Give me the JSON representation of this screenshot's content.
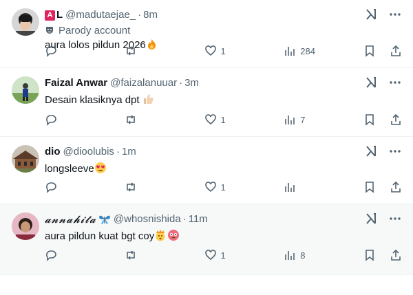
{
  "posts": [
    {
      "badge": "A",
      "name": "L",
      "handle": "@madutaejae_",
      "dot": "·",
      "time": "8m",
      "parody": "Parody account",
      "text": "aura lolos pildun 2026",
      "emoji": "fire",
      "replies": "",
      "reposts": "",
      "likes": "1",
      "views": "284"
    },
    {
      "name": "Faizal Anwar",
      "handle": "@faizalanuuar",
      "dot": "·",
      "time": "3m",
      "text": "Desain klasiknya dpt",
      "emoji": "thumbs-up",
      "replies": "",
      "reposts": "",
      "likes": "1",
      "views": "7"
    },
    {
      "name": "dio",
      "handle": "@dioolubis",
      "dot": "·",
      "time": "1m",
      "text": "longsleeve",
      "emoji": "heart-eyes",
      "replies": "",
      "reposts": "",
      "likes": "1",
      "views": ""
    },
    {
      "name": "𝓪𝓷𝓷𝓪𝓱𝓲𝓽𝓪",
      "name_emoji": "butterfly",
      "handle": "@whosnishida",
      "dot": "·",
      "time": "11m",
      "text": "aura pildun kuat bgt coy",
      "emoji": "exploding-head, flushed",
      "replies": "",
      "reposts": "",
      "likes": "1",
      "views": "8"
    }
  ],
  "colors": {
    "accent": "#1d9bf0",
    "muted": "#536471",
    "badge": "#e0245e",
    "fire": "#f4900c"
  }
}
